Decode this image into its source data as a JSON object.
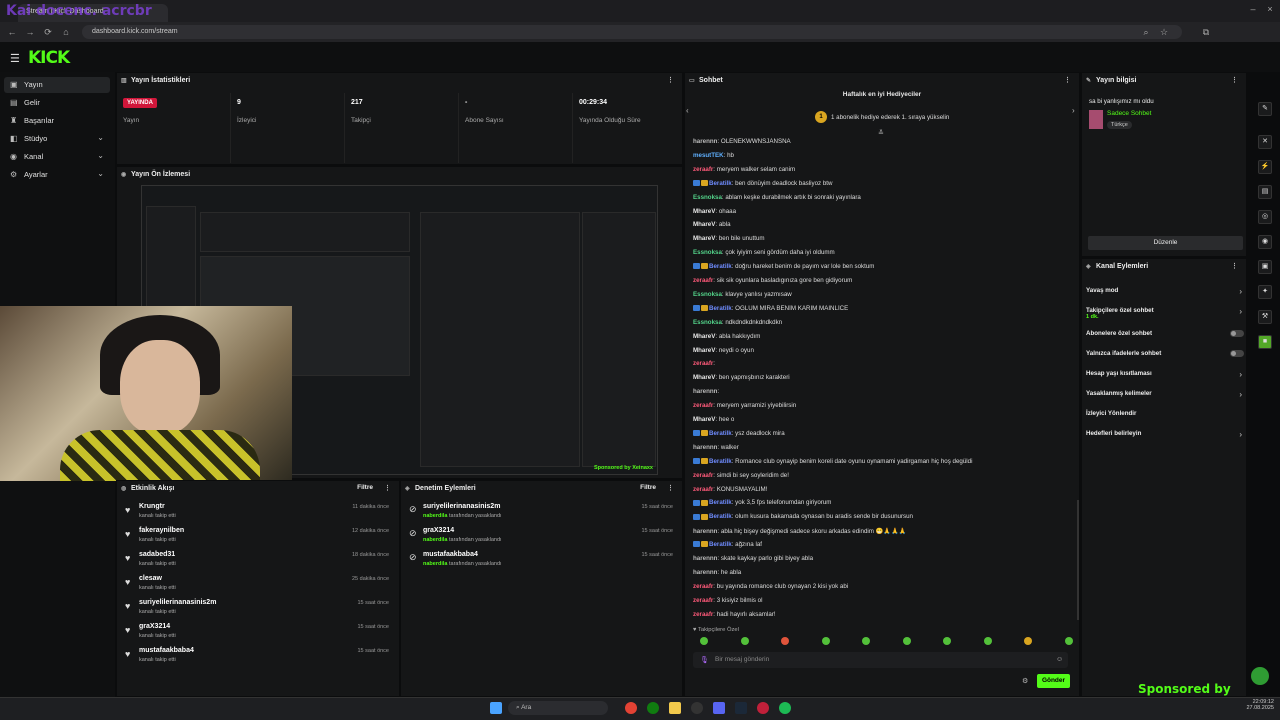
{
  "browser": {
    "tab_title": "Stream | Kick Dashboard",
    "url": "dashboard.kick.com/stream",
    "overlay_text": "Kai docenc. acrcbr"
  },
  "logo": "KICK",
  "sidebar": {
    "items": [
      {
        "label": "Yayın",
        "icon": "video-icon"
      },
      {
        "label": "Gelir",
        "icon": "dollar-icon"
      },
      {
        "label": "Başarılar",
        "icon": "trophy-icon"
      },
      {
        "label": "Stüdyo",
        "icon": "studio-icon"
      },
      {
        "label": "Kanal",
        "icon": "user-icon"
      },
      {
        "label": "Ayarlar",
        "icon": "gear-icon"
      }
    ]
  },
  "stats_panel": {
    "title": "Yayın İstatistikleri",
    "items": [
      {
        "value": "YAYINDA",
        "label": "Yayın"
      },
      {
        "value": "9",
        "label": "İzleyici"
      },
      {
        "value": "217",
        "label": "Takipçi"
      },
      {
        "value": "-",
        "label": "Abone Sayısı"
      },
      {
        "value": "00:29:34",
        "label": "Yayında Olduğu Süre"
      }
    ]
  },
  "preview_panel": {
    "title": "Yayın Ön İzlemesi",
    "sponsor_mini": "Sponsored by Xeinaxx"
  },
  "activity_panel": {
    "title": "Etkinlik Akışı",
    "filter": "Filtre",
    "items": [
      {
        "name": "Krungtr",
        "sub": "kanalı takip etti",
        "time": "11 dakika önce"
      },
      {
        "name": "fakeraynilben",
        "sub": "kanalı takip etti",
        "time": "12 dakika önce"
      },
      {
        "name": "sadabed31",
        "sub": "kanalı takip etti",
        "time": "18 dakika önce"
      },
      {
        "name": "clesaw",
        "sub": "kanalı takip etti",
        "time": "25 dakika önce"
      },
      {
        "name": "suriyelilerinanasinis2m",
        "sub": "kanalı takip etti",
        "time": "15 saat önce"
      },
      {
        "name": "graX3214",
        "sub": "kanalı takip etti",
        "time": "15 saat önce"
      },
      {
        "name": "mustafaakbaba4",
        "sub": "kanalı takip etti",
        "time": "15 saat önce"
      }
    ]
  },
  "moderation_panel": {
    "title": "Denetim Eylemleri",
    "filter": "Filtre",
    "items": [
      {
        "name": "suriyelilerinanasinis2m",
        "by": "naberdila",
        "sub": "tarafından yasaklandı",
        "time": "15 saat önce"
      },
      {
        "name": "graX3214",
        "by": "naberdila",
        "sub": "tarafından yasaklandı",
        "time": "15 saat önce"
      },
      {
        "name": "mustafaakbaba4",
        "by": "naberdila",
        "sub": "tarafından yasaklandı",
        "time": "15 saat önce"
      }
    ]
  },
  "chat_panel": {
    "title": "Sohbet",
    "gifters_title": "Haftalık en iyi Hediyeciler",
    "gifters_sub": "1 abonelik hediye ederek 1. sıraya yükselin",
    "gifters_rank": "1",
    "messages": [
      {
        "user": "harennn",
        "text": "OLENEKWWNSJANSNA",
        "color": "#bbbbbb",
        "badges": 0
      },
      {
        "user": "mesutTEK",
        "text": "hb",
        "color": "#5fb0ff",
        "badges": 0
      },
      {
        "user": "zeraafr",
        "text": "meryem walker selam canim",
        "color": "#ff5a7a",
        "badges": 0
      },
      {
        "user": "Beratilk",
        "text": "ben dönüyim deadlock basliyoz btw",
        "color": "#6f8cff",
        "badges": 2
      },
      {
        "user": "Essnoksa",
        "text": "ablam keşke durabilmek artık bi sonraki yayınlara",
        "color": "#53d38a",
        "badges": 0
      },
      {
        "user": "MhareV",
        "text": "ohaaa",
        "color": "#e6e6e6",
        "badges": 0
      },
      {
        "user": "MhareV",
        "text": "abla",
        "color": "#e6e6e6",
        "badges": 0
      },
      {
        "user": "MhareV",
        "text": "ben bile unuttum",
        "color": "#e6e6e6",
        "badges": 0
      },
      {
        "user": "Essnoksa",
        "text": "çok iyiyim seni gördüm daha iyi oldumm",
        "color": "#53d38a",
        "badges": 0
      },
      {
        "user": "Beratilk",
        "text": "doğru hareket benim de payım var lole ben soktum",
        "color": "#6f8cff",
        "badges": 2
      },
      {
        "user": "zeraafr",
        "text": "sik sik oyunlara basladıgınıza gore ben gidiyorum",
        "color": "#ff5a7a",
        "badges": 0
      },
      {
        "user": "Essnoksa",
        "text": "klavye yanlısı yazmısaw",
        "color": "#53d38a",
        "badges": 0
      },
      {
        "user": "Beratilk",
        "text": "OĞLUM MİRA BENİM KARIM MAINLİCE",
        "color": "#6f8cff",
        "badges": 2
      },
      {
        "user": "Essnoksa",
        "text": "ndkdndkdnkdndkdkn",
        "color": "#53d38a",
        "badges": 0
      },
      {
        "user": "MhareV",
        "text": "abla hakkıydım",
        "color": "#e6e6e6",
        "badges": 0
      },
      {
        "user": "MhareV",
        "text": "neydi o oyun",
        "color": "#e6e6e6",
        "badges": 0
      },
      {
        "user": "zeraafr",
        "text": "",
        "color": "#ff5a7a",
        "badges": 0
      },
      {
        "user": "MhareV",
        "text": "ben yapmışbınız karakteri",
        "color": "#e6e6e6",
        "badges": 0
      },
      {
        "user": "harennn",
        "text": "",
        "color": "#bbbbbb",
        "badges": 0
      },
      {
        "user": "zeraafr",
        "text": "meryem yarramizi yiyebilirsin",
        "color": "#ff5a7a",
        "badges": 0
      },
      {
        "user": "MhareV",
        "text": "hee o",
        "color": "#e6e6e6",
        "badges": 0
      },
      {
        "user": "Beratilk",
        "text": "ysz deadlock mira",
        "color": "#6f8cff",
        "badges": 2
      },
      {
        "user": "harennn",
        "text": "walker",
        "color": "#bbbbbb",
        "badges": 0
      },
      {
        "user": "Beratilk",
        "text": "Romance club oynayip benim koreli date oyunu oynamami yadirgaman hiç hoş degüldi",
        "color": "#6f8cff",
        "badges": 2
      },
      {
        "user": "zeraafr",
        "text": "simdi bi sey soyleridim de!",
        "color": "#ff5a7a",
        "badges": 0
      },
      {
        "user": "zeraafr",
        "text": "KONUSMAYALIM!",
        "color": "#ff5a7a",
        "badges": 0
      },
      {
        "user": "Beratilk",
        "text": "yok 3,5 fps telefonumdan giriyorum",
        "color": "#6f8cff",
        "badges": 2
      },
      {
        "user": "Beratilk",
        "text": "olum kusura bakamada oynasan bu aradis sende bir dusunursun",
        "color": "#6f8cff",
        "badges": 2
      },
      {
        "user": "harennn",
        "text": "abla hiç bişey değişmedi sadece skoru arkadas edindim 😁🙏🙏🙏",
        "color": "#bbbbbb",
        "badges": 0
      },
      {
        "user": "Beratilk",
        "text": "ağzına laf",
        "color": "#6f8cff",
        "badges": 2
      },
      {
        "user": "harennn",
        "text": "skate kaykay parlo gibi biyey abla",
        "color": "#bbbbbb",
        "badges": 0
      },
      {
        "user": "harennn",
        "text": "he abla",
        "color": "#bbbbbb",
        "badges": 0
      },
      {
        "user": "zeraafr",
        "text": "bu yayında romance club oynayan 2 kisi yok abi",
        "color": "#ff5a7a",
        "badges": 0
      },
      {
        "user": "zeraafr",
        "text": "3 kisiyiz bilmis ol",
        "color": "#ff5a7a",
        "badges": 0
      },
      {
        "user": "zeraafr",
        "text": "hadi hayırlı aksamlar!",
        "color": "#ff5a7a",
        "badges": 0
      }
    ],
    "followers_only": "Takipçilere Özel",
    "input_placeholder": "Bir mesaj gönderin",
    "send_label": "Gönder"
  },
  "stream_info": {
    "title": "Yayın bilgisi",
    "stream_title": "sa bi yanlışımız mı oldu",
    "category": "Sadece Sohbet",
    "tag": "Türkçe",
    "edit_label": "Düzenle"
  },
  "channel_actions": {
    "title": "Kanal Eylemleri",
    "items": [
      {
        "label": "Yavaş mod",
        "control": "chevron"
      },
      {
        "label": "Takipçilere özel sohbet",
        "sub": "1 dk.",
        "control": "chevron"
      },
      {
        "label": "Abonelere özel sohbet",
        "control": "toggle"
      },
      {
        "label": "Yalnızca ifadelerle sohbet",
        "control": "toggle"
      },
      {
        "label": "Hesap yaşı kısıtlaması",
        "control": "chevron"
      },
      {
        "label": "Yasaklanmış kelimeler",
        "control": "chevron"
      },
      {
        "label": "İzleyici Yönlendir",
        "control": "none"
      },
      {
        "label": "Hedefleri belirleyin",
        "control": "chevron"
      }
    ]
  },
  "taskbar": {
    "search": "Ara",
    "clock": "22:09:12",
    "date": "27.08.2025"
  },
  "sponsor_text": "Sponsored by Xeinaxx",
  "colors": {
    "brand": "#53fc18",
    "live": "#d1163a",
    "bg": "#0b0c0d"
  }
}
